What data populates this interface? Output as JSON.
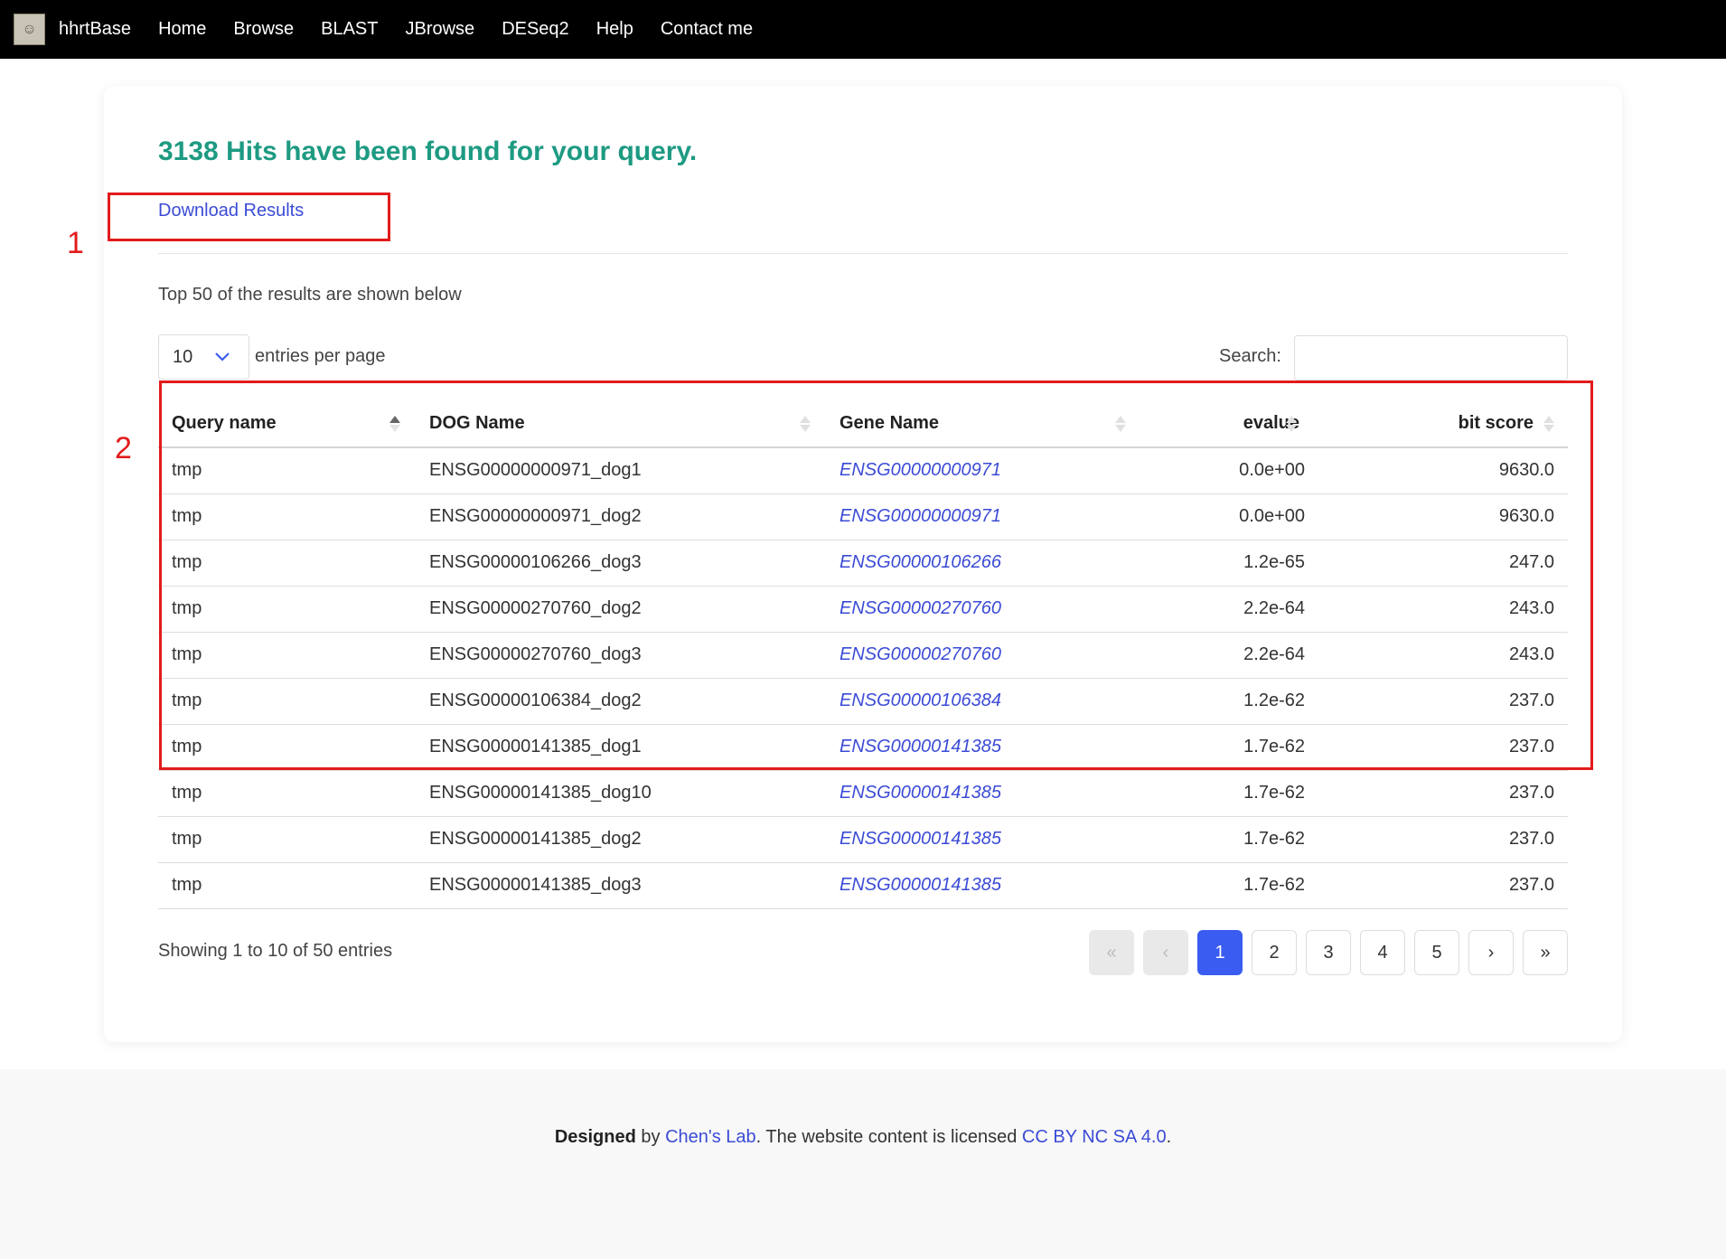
{
  "nav": {
    "brand": "hhrtBase",
    "items": [
      "Home",
      "Browse",
      "BLAST",
      "JBrowse",
      "DESeq2",
      "Help",
      "Contact me"
    ]
  },
  "headline": "3138 Hits have been found for your query.",
  "download_label": "Download Results",
  "top_note": "Top 50 of the results are shown below",
  "length_menu": {
    "value": "10",
    "label": "entries per page"
  },
  "search": {
    "label": "Search:",
    "value": ""
  },
  "table": {
    "columns": [
      "Query name",
      "DOG Name",
      "Gene Name",
      "evalue",
      "bit score"
    ],
    "rows": [
      [
        "tmp",
        "ENSG00000000971_dog1",
        "ENSG00000000971",
        "0.0e+00",
        "9630.0"
      ],
      [
        "tmp",
        "ENSG00000000971_dog2",
        "ENSG00000000971",
        "0.0e+00",
        "9630.0"
      ],
      [
        "tmp",
        "ENSG00000106266_dog3",
        "ENSG00000106266",
        "1.2e-65",
        "247.0"
      ],
      [
        "tmp",
        "ENSG00000270760_dog2",
        "ENSG00000270760",
        "2.2e-64",
        "243.0"
      ],
      [
        "tmp",
        "ENSG00000270760_dog3",
        "ENSG00000270760",
        "2.2e-64",
        "243.0"
      ],
      [
        "tmp",
        "ENSG00000106384_dog2",
        "ENSG00000106384",
        "1.2e-62",
        "237.0"
      ],
      [
        "tmp",
        "ENSG00000141385_dog1",
        "ENSG00000141385",
        "1.7e-62",
        "237.0"
      ],
      [
        "tmp",
        "ENSG00000141385_dog10",
        "ENSG00000141385",
        "1.7e-62",
        "237.0"
      ],
      [
        "tmp",
        "ENSG00000141385_dog2",
        "ENSG00000141385",
        "1.7e-62",
        "237.0"
      ],
      [
        "tmp",
        "ENSG00000141385_dog3",
        "ENSG00000141385",
        "1.7e-62",
        "237.0"
      ]
    ]
  },
  "info": "Showing 1 to 10 of 50 entries",
  "pagination": {
    "first": "«",
    "prev": "‹",
    "next": "›",
    "last": "»",
    "pages": [
      "1",
      "2",
      "3",
      "4",
      "5"
    ],
    "current": "1"
  },
  "annotations": {
    "box1": "1",
    "box2": "2"
  },
  "footer": {
    "designed": "Designed",
    "by": " by ",
    "lab": "Chen's Lab",
    "middle": ". The website content is licensed ",
    "license": "CC BY NC SA 4.0",
    "end": "."
  },
  "colors": {
    "headline": "#1d9a82",
    "link": "#3b4bd6",
    "pager_active": "#3a5cf0",
    "annotation": "#e21b1b",
    "navbar": "#000000"
  },
  "icons": {
    "logo": "site-logo-icon",
    "select": "chevron-down-icon",
    "sort": "sort-arrows-icon"
  }
}
